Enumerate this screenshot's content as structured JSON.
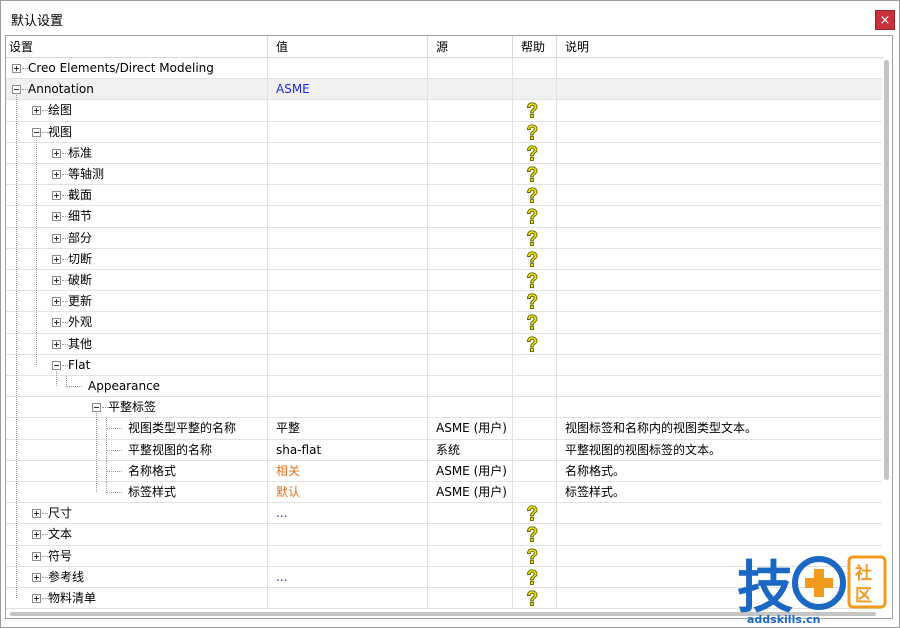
{
  "window": {
    "title": "默认设置",
    "close_icon": "×"
  },
  "columns": {
    "setting": "设置",
    "value": "值",
    "source": "源",
    "help": "帮助",
    "desc": "说明"
  },
  "rows": [
    {
      "label": "Creo Elements/Direct Modeling",
      "level": 0,
      "toggle": "plus",
      "value": "",
      "value_color": "",
      "source": "",
      "help": false,
      "desc": ""
    },
    {
      "label": "Annotation",
      "level": 0,
      "toggle": "minus",
      "value": "ASME",
      "value_color": "blue",
      "source": "",
      "help": false,
      "desc": "",
      "selected": true
    },
    {
      "label": "绘图",
      "level": 1,
      "toggle": "plus",
      "value": "",
      "value_color": "",
      "source": "",
      "help": true,
      "desc": ""
    },
    {
      "label": "视图",
      "level": 1,
      "toggle": "minus",
      "value": "",
      "value_color": "",
      "source": "",
      "help": true,
      "desc": ""
    },
    {
      "label": "标准",
      "level": 2,
      "toggle": "plus",
      "value": "",
      "value_color": "",
      "source": "",
      "help": true,
      "desc": ""
    },
    {
      "label": "等轴测",
      "level": 2,
      "toggle": "plus",
      "value": "",
      "value_color": "",
      "source": "",
      "help": true,
      "desc": ""
    },
    {
      "label": "截面",
      "level": 2,
      "toggle": "plus",
      "value": "",
      "value_color": "",
      "source": "",
      "help": true,
      "desc": ""
    },
    {
      "label": "细节",
      "level": 2,
      "toggle": "plus",
      "value": "",
      "value_color": "",
      "source": "",
      "help": true,
      "desc": ""
    },
    {
      "label": "部分",
      "level": 2,
      "toggle": "plus",
      "value": "",
      "value_color": "",
      "source": "",
      "help": true,
      "desc": ""
    },
    {
      "label": "切断",
      "level": 2,
      "toggle": "plus",
      "value": "",
      "value_color": "",
      "source": "",
      "help": true,
      "desc": ""
    },
    {
      "label": "破断",
      "level": 2,
      "toggle": "plus",
      "value": "",
      "value_color": "",
      "source": "",
      "help": true,
      "desc": ""
    },
    {
      "label": "更新",
      "level": 2,
      "toggle": "plus",
      "value": "",
      "value_color": "",
      "source": "",
      "help": true,
      "desc": ""
    },
    {
      "label": "外观",
      "level": 2,
      "toggle": "plus",
      "value": "",
      "value_color": "",
      "source": "",
      "help": true,
      "desc": ""
    },
    {
      "label": "其他",
      "level": 2,
      "toggle": "plus",
      "value": "",
      "value_color": "",
      "source": "",
      "help": true,
      "desc": ""
    },
    {
      "label": "Flat",
      "level": 2,
      "toggle": "minus",
      "value": "",
      "value_color": "",
      "source": "",
      "help": false,
      "desc": ""
    },
    {
      "label": "Appearance",
      "level": 3,
      "toggle": "none",
      "value": "",
      "value_color": "",
      "source": "",
      "help": false,
      "desc": ""
    },
    {
      "label": "平整标签",
      "level": 4,
      "toggle": "minus",
      "value": "",
      "value_color": "",
      "source": "",
      "help": false,
      "desc": ""
    },
    {
      "label": "视图类型平整的名称",
      "level": 5,
      "toggle": "leaf",
      "value": "平整",
      "value_color": "",
      "source": "ASME (用户)",
      "help": false,
      "desc": "视图标签和名称内的视图类型文本。"
    },
    {
      "label": "平整视图的名称",
      "level": 5,
      "toggle": "leaf",
      "value": "sha-flat",
      "value_color": "",
      "source": "系统",
      "help": false,
      "desc": "平整视图的视图标签的文本。"
    },
    {
      "label": "名称格式",
      "level": 5,
      "toggle": "leaf",
      "value": "相关",
      "value_color": "orange",
      "source": "ASME (用户)",
      "help": false,
      "desc": "名称格式。"
    },
    {
      "label": "标签样式",
      "level": 5,
      "toggle": "leaf",
      "value": "默认",
      "value_color": "orange",
      "source": "ASME (用户)",
      "help": false,
      "desc": "标签样式。"
    },
    {
      "label": "尺寸",
      "level": 1,
      "toggle": "plus",
      "value": "...",
      "value_color": "blue",
      "source": "",
      "help": true,
      "desc": ""
    },
    {
      "label": "文本",
      "level": 1,
      "toggle": "plus",
      "value": "",
      "value_color": "",
      "source": "",
      "help": true,
      "desc": ""
    },
    {
      "label": "符号",
      "level": 1,
      "toggle": "plus",
      "value": "",
      "value_color": "",
      "source": "",
      "help": true,
      "desc": ""
    },
    {
      "label": "参考线",
      "level": 1,
      "toggle": "plus",
      "value": "...",
      "value_color": "blue",
      "source": "",
      "help": true,
      "desc": ""
    },
    {
      "label": "物料清单",
      "level": 1,
      "toggle": "plus",
      "value": "",
      "value_color": "",
      "source": "",
      "help": true,
      "desc": ""
    }
  ],
  "watermark": {
    "logo_text": "技",
    "badge_text": "社区",
    "site": "addskills.cn",
    "colors": {
      "blue": "#1a67c4",
      "orange": "#f29a1e"
    }
  }
}
